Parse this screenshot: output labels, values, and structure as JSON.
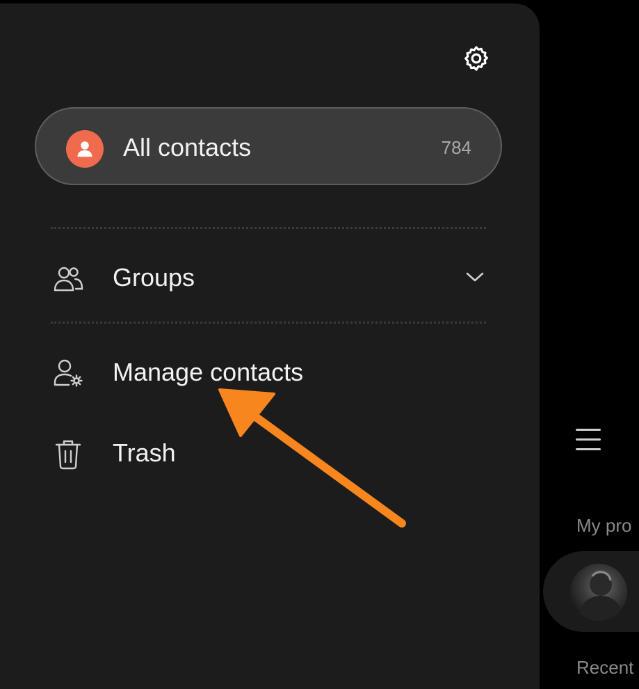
{
  "drawer": {
    "settings_icon": "gear-icon",
    "all_contacts": {
      "label": "All contacts",
      "count": "784",
      "icon": "person-icon",
      "badge_color": "#f06a4e"
    },
    "items": [
      {
        "label": "Groups",
        "icon": "groups-icon",
        "trailing_icon": "chevron-down-icon"
      },
      {
        "label": "Manage contacts",
        "icon": "manage-contacts-icon"
      },
      {
        "label": "Trash",
        "icon": "trash-icon"
      }
    ]
  },
  "background_app": {
    "menu_icon": "hamburger-icon",
    "my_profile_label": "My pro",
    "recents_label": "Recent"
  },
  "annotation": {
    "arrow_color": "#f7861e",
    "points_to": "Manage contacts"
  }
}
